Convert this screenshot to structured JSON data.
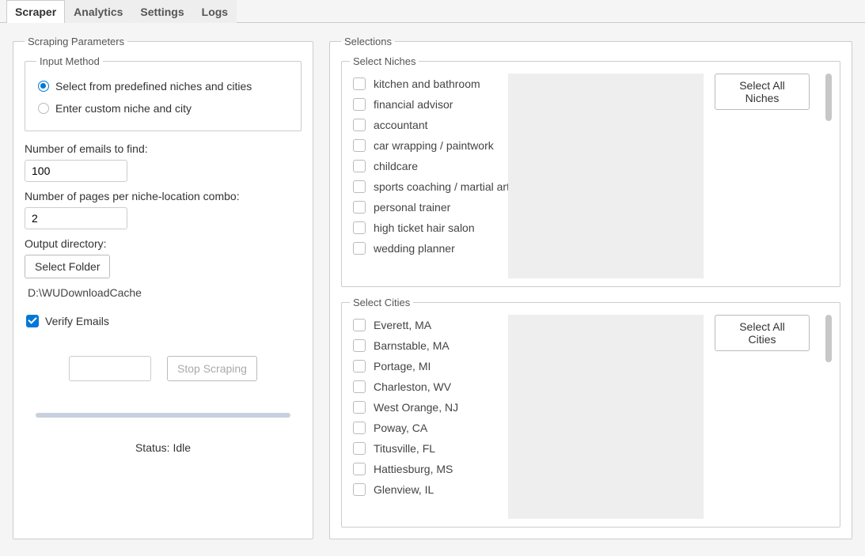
{
  "tabs": [
    "Scraper",
    "Analytics",
    "Settings",
    "Logs"
  ],
  "activeTab": 0,
  "scrapingParams": {
    "legend": "Scraping Parameters",
    "inputMethod": {
      "legend": "Input Method",
      "options": [
        {
          "label": "Select from predefined niches and cities",
          "checked": true
        },
        {
          "label": "Enter custom niche and city",
          "checked": false
        }
      ]
    },
    "emailsLabel": "Number of emails to find:",
    "emailsValue": "100",
    "pagesLabel": "Number of pages per niche-location combo:",
    "pagesValue": "2",
    "outputDirLabel": "Output directory:",
    "selectFolderBtn": "Select Folder",
    "outputPath": "D:\\WUDownloadCache",
    "verifyEmailsLabel": "Verify Emails",
    "verifyEmailsChecked": true,
    "stopBtn": "Stop Scraping",
    "statusPrefix": "Status: ",
    "statusValue": "Idle"
  },
  "selections": {
    "legend": "Selections",
    "niches": {
      "legend": "Select Niches",
      "selectAllBtn": "Select All Niches",
      "items": [
        "kitchen and bathroom",
        "financial advisor",
        "accountant",
        "car wrapping / paintwork",
        "childcare",
        "sports coaching / martial arts",
        "personal trainer",
        "high ticket hair salon",
        "wedding planner"
      ]
    },
    "cities": {
      "legend": "Select Cities",
      "selectAllBtn": "Select All Cities",
      "items": [
        "Everett, MA",
        "Barnstable, MA",
        "Portage, MI",
        "Charleston, WV",
        "West Orange, NJ",
        "Poway, CA",
        "Titusville, FL",
        "Hattiesburg, MS",
        "Glenview, IL"
      ]
    }
  }
}
